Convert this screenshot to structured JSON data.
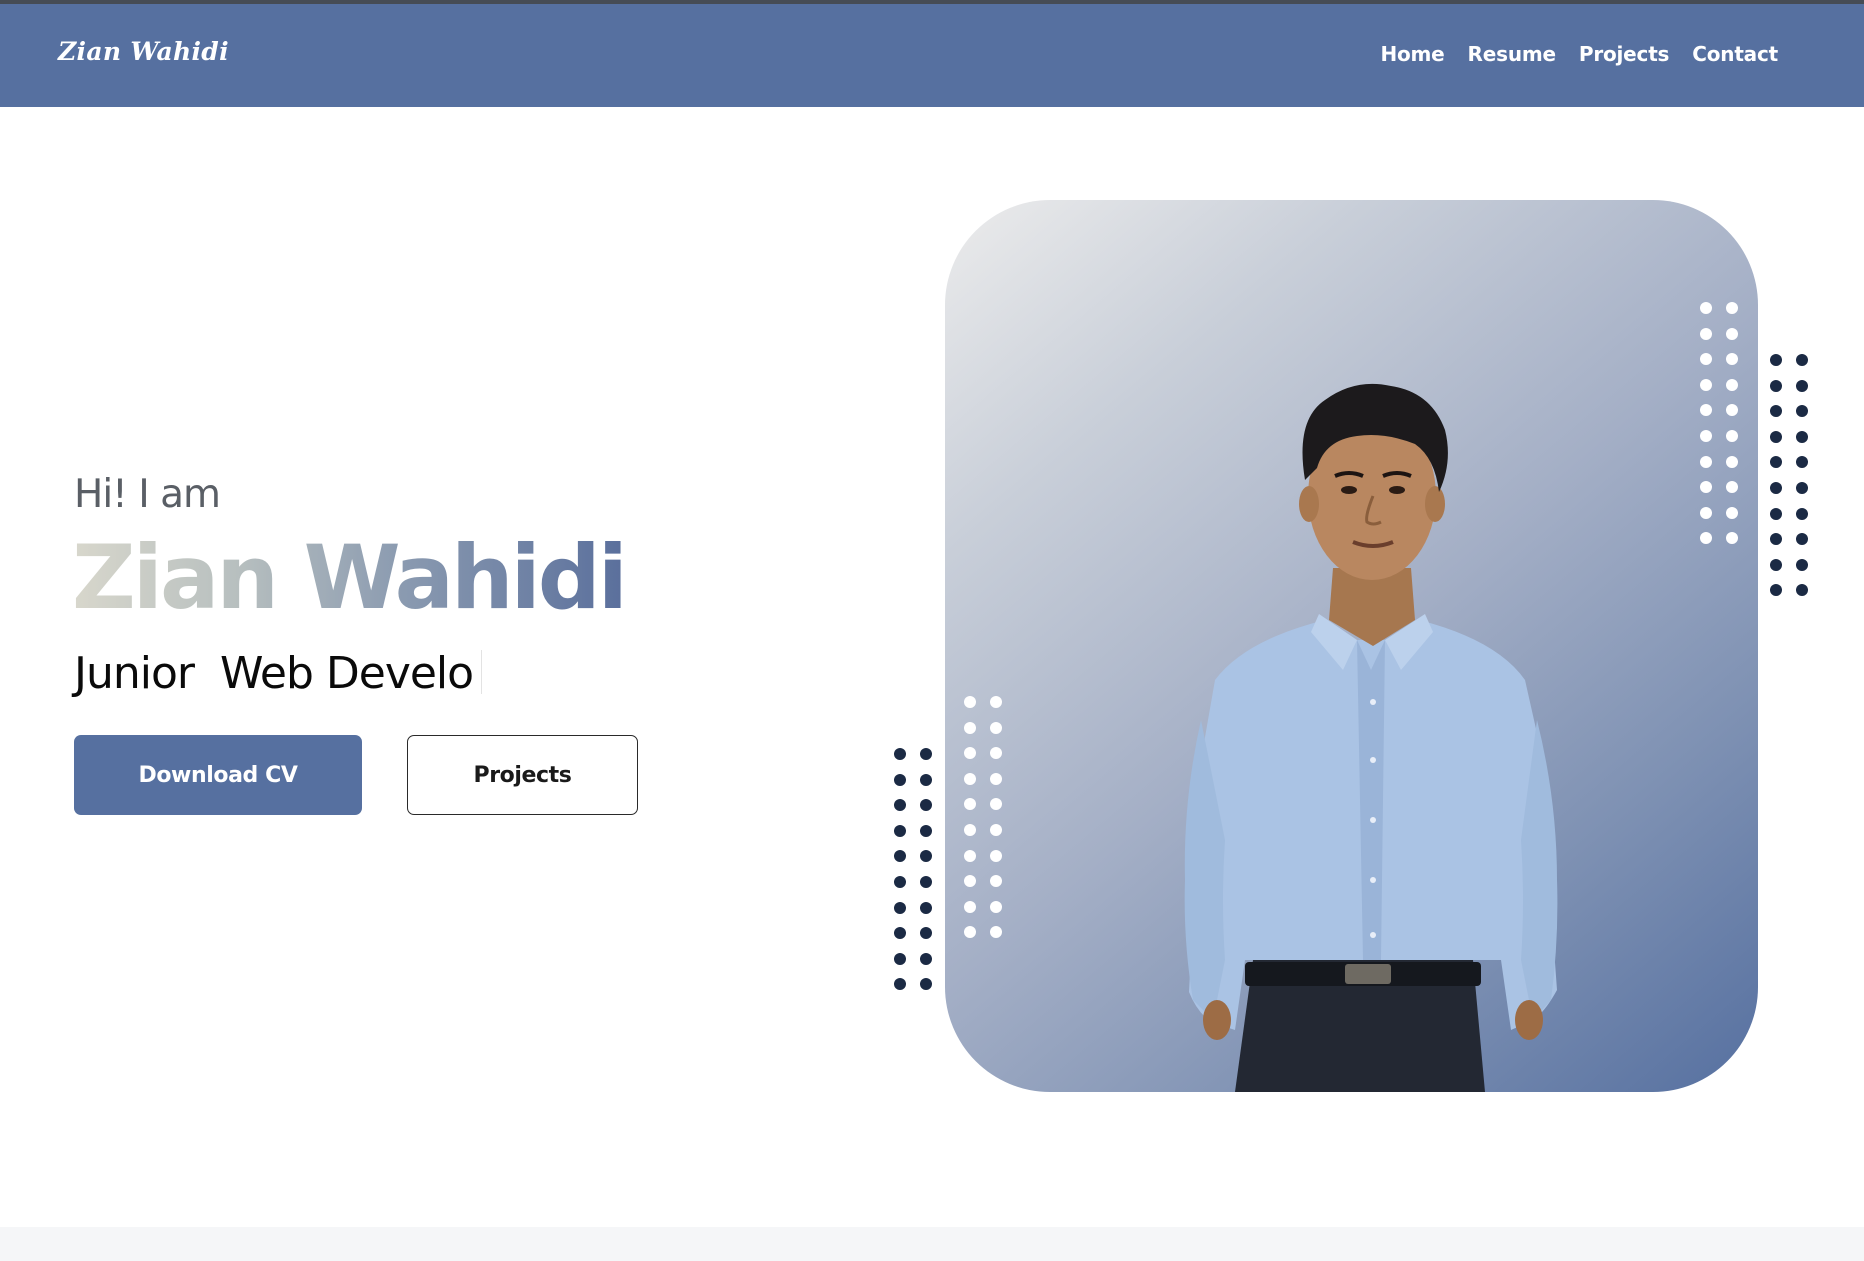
{
  "navbar": {
    "brand": "Zian Wahidi",
    "links": [
      "Home",
      "Resume",
      "Projects",
      "Contact"
    ]
  },
  "hero": {
    "greeting": "Hi! I am",
    "name": "Zian Wahidi",
    "role_typed": "Junior  Web Develo",
    "buttons": {
      "primary": "Download CV",
      "secondary": "Projects"
    }
  },
  "colors": {
    "brand_primary": "#5670a0",
    "dot_navy": "#1b2a44",
    "white": "#ffffff"
  },
  "icons": {
    "photo": "person-portrait",
    "decor": "dot-grid"
  }
}
